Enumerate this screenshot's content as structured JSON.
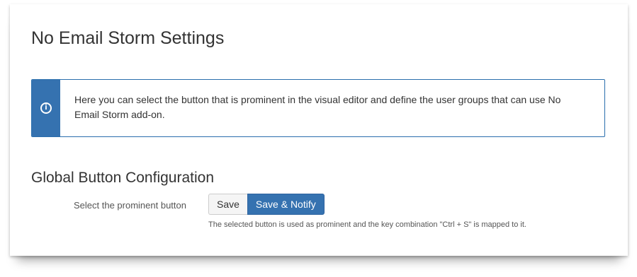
{
  "page": {
    "title": "No Email Storm Settings"
  },
  "info_message": {
    "icon": "info-icon",
    "text": "Here you can select the button that is prominent in the visual editor and define the user groups that can use No Email Storm add-on."
  },
  "global_button_config": {
    "title": "Global Button Configuration",
    "field_label": "Select the prominent button",
    "options": [
      "Save",
      "Save & Notify"
    ],
    "selected": "Save & Notify",
    "help_text": "The selected button is used as prominent and the key combination \"Ctrl + S\" is mapped to it."
  },
  "colors": {
    "accent": "#3572b0",
    "text": "#333333"
  }
}
